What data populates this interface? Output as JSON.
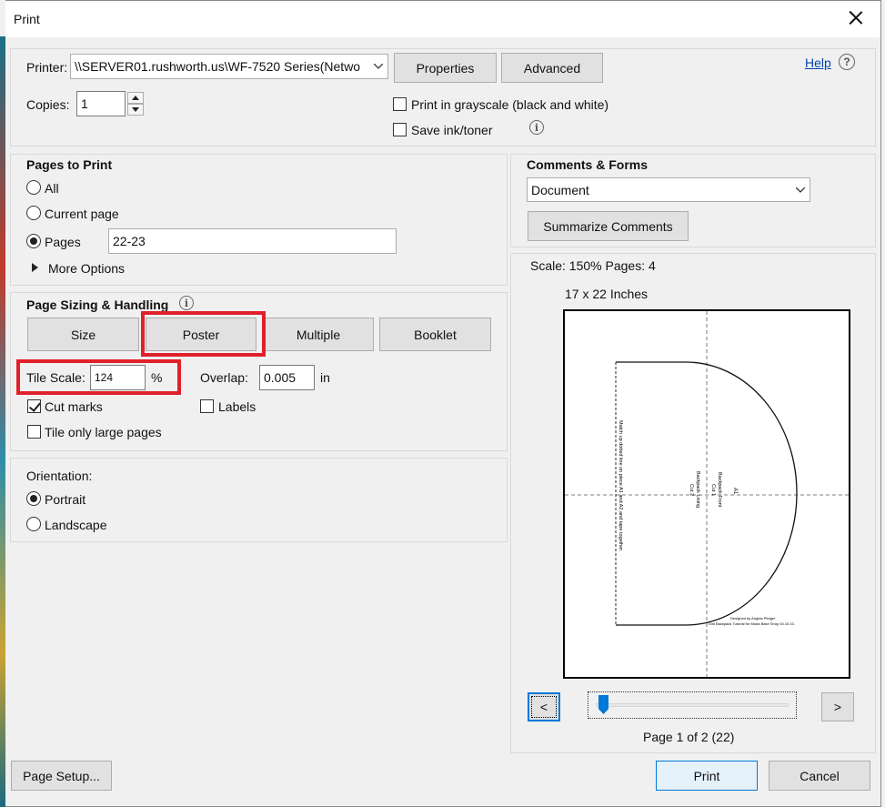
{
  "window": {
    "title": "Print"
  },
  "printer": {
    "label": "Printer:",
    "value": "\\\\SERVER01.rushworth.us\\WF-7520 Series(Netwo",
    "properties_button": "Properties",
    "advanced_button": "Advanced",
    "help_link": "Help"
  },
  "copies": {
    "label": "Copies:",
    "value": "1"
  },
  "options": {
    "grayscale_label": "Print in grayscale (black and white)",
    "grayscale_checked": false,
    "save_ink_label": "Save ink/toner",
    "save_ink_checked": false
  },
  "pages_to_print": {
    "heading": "Pages to Print",
    "all_label": "All",
    "current_label": "Current page",
    "pages_label": "Pages",
    "pages_value": "22-23",
    "more_options_label": "More Options"
  },
  "sizing": {
    "heading": "Page Sizing & Handling",
    "tabs": [
      "Size",
      "Poster",
      "Multiple",
      "Booklet"
    ],
    "selected_tab": "Poster",
    "tile_scale_label": "Tile Scale:",
    "tile_scale_value": "124",
    "tile_scale_unit": "%",
    "overlap_label": "Overlap:",
    "overlap_value": "0.005",
    "overlap_unit": "in",
    "cut_marks_label": "Cut marks",
    "cut_marks_checked": true,
    "labels_label": "Labels",
    "labels_checked": false,
    "tile_only_label": "Tile only large pages",
    "tile_only_checked": false
  },
  "orientation": {
    "heading": "Orientation:",
    "portrait_label": "Portrait",
    "landscape_label": "Landscape",
    "selected": "Portrait"
  },
  "comments_forms": {
    "heading": "Comments & Forms",
    "value": "Document",
    "summarize_button": "Summarize Comments"
  },
  "preview": {
    "scale_text": "Scale: 150% Pages: 4",
    "size_text": "17 x 22 Inches",
    "page_text": "Page 1 of 2 (22)",
    "prev_button": "<",
    "next_button": ">",
    "pattern_text_left": "Match up dotted line on piece A1 and A2 and tape together.",
    "pattern_text_mid1": "Backpack Front",
    "pattern_text_mid2": "Cut 1",
    "pattern_text_mid3": "Backpack Lining",
    "pattern_text_mid4": "Cut 2",
    "pattern_text_a1": "A1",
    "pattern_credit1": "Designed by Angela Pfeiger",
    "pattern_credit2": "Owl Backpack Tutorial for Moda Bake Shop 04.10.10.",
    "slider_position": 0
  },
  "footer": {
    "page_setup_button": "Page Setup...",
    "print_button": "Print",
    "cancel_button": "Cancel"
  }
}
